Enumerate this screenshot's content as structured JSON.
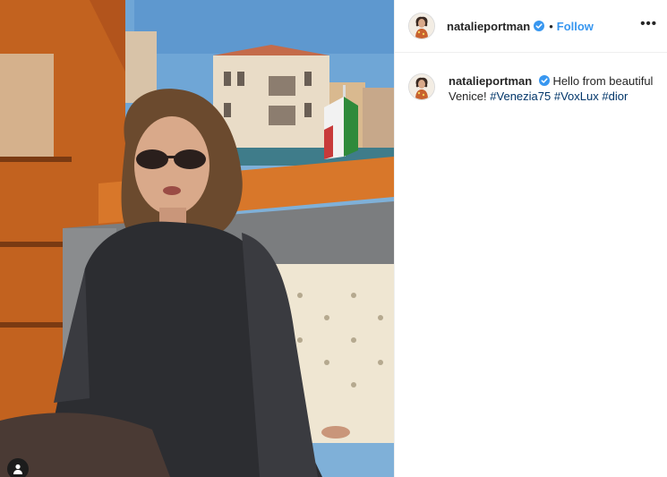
{
  "post": {
    "username": "natalieportman",
    "verified": true,
    "follow_separator": "•",
    "follow_label": "Follow",
    "more_label": "•••",
    "caption_username": "natalieportman",
    "caption_text": "Hello from beautiful Venice!",
    "hashtags": [
      "#Venezia75",
      "#VoxLux",
      "#dior"
    ]
  },
  "colors": {
    "link": "#3897f0",
    "hashtag": "#003569",
    "verified": "#3897f0"
  },
  "icons": {
    "verified": "verified-badge-icon",
    "more": "more-options-icon",
    "user_tag": "user-tag-icon"
  }
}
